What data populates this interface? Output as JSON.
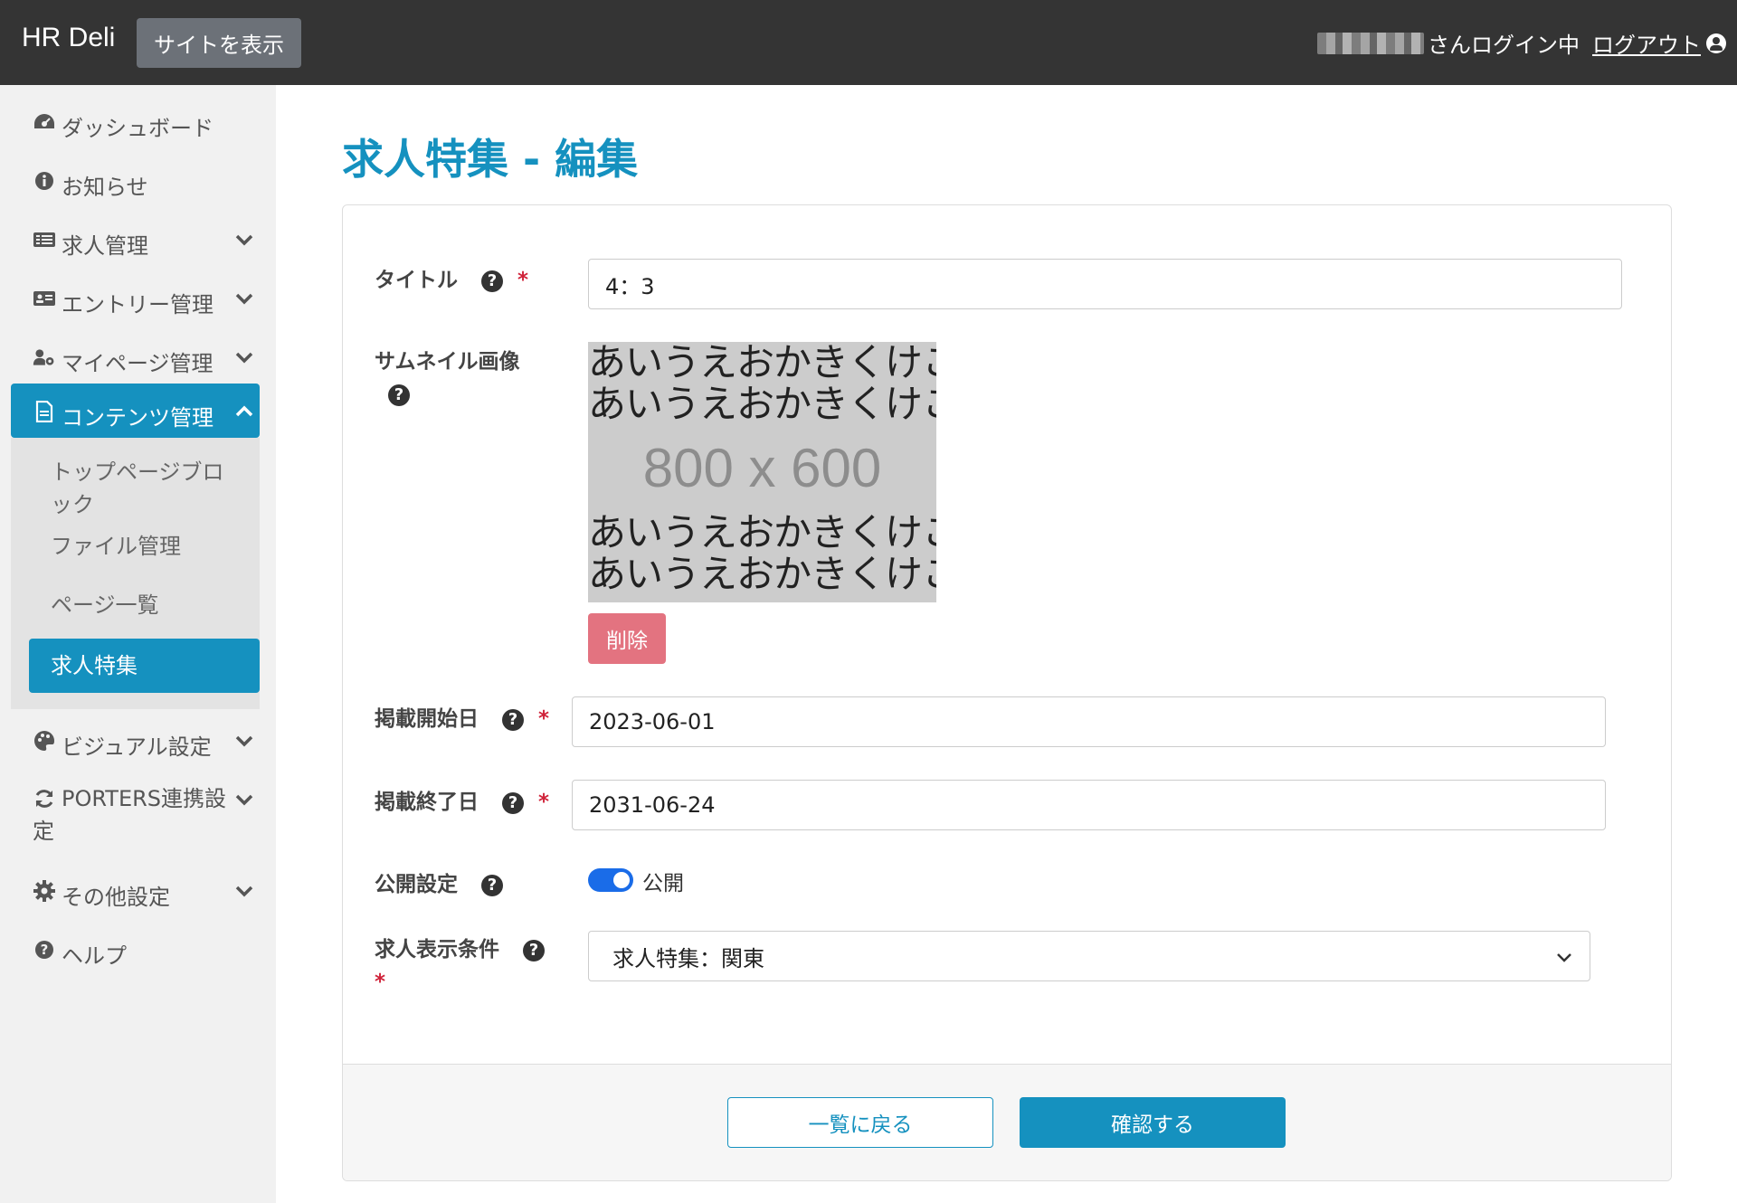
{
  "header": {
    "brand": "HR Deli",
    "site_button": "サイトを表示",
    "user_suffix": "さんログイン中",
    "logout": "ログアウト"
  },
  "sidebar": {
    "items": [
      {
        "label": "ダッシュボード",
        "icon": "dashboard-icon"
      },
      {
        "label": "お知らせ",
        "icon": "info-icon"
      },
      {
        "label": "求人管理",
        "icon": "list-icon",
        "expandable": true
      },
      {
        "label": "エントリー管理",
        "icon": "id-card-icon",
        "expandable": true
      },
      {
        "label": "マイページ管理",
        "icon": "user-gear-icon",
        "expandable": true
      },
      {
        "label": "コンテンツ管理",
        "icon": "file-icon",
        "expandable": true,
        "expanded": true
      },
      {
        "label": "ビジュアル設定",
        "icon": "palette-icon",
        "expandable": true
      },
      {
        "label": "PORTERS連携設定",
        "icon": "sync-icon",
        "expandable": true
      },
      {
        "label": "その他設定",
        "icon": "gear-icon",
        "expandable": true
      },
      {
        "label": "ヘルプ",
        "icon": "question-icon"
      }
    ],
    "submenu": [
      {
        "label": "トップページブロック"
      },
      {
        "label": "ファイル管理"
      },
      {
        "label": "ページ一覧"
      },
      {
        "label": "求人特集",
        "active": true
      }
    ]
  },
  "page": {
    "title": "求人特集 - 編集"
  },
  "form": {
    "title_label": "タイトル",
    "title_value": "4：3",
    "thumbnail_label": "サムネイル画像",
    "thumbnail_text_line": "あいうえおかきくけこさ",
    "thumbnail_size": "800 x 600",
    "delete_button": "削除",
    "start_label": "掲載開始日",
    "start_value": "2023-06-01",
    "end_label": "掲載終了日",
    "end_value": "2031-06-24",
    "publish_label": "公開設定",
    "publish_state": "公開",
    "publish_on": true,
    "condition_label": "求人表示条件",
    "condition_value": "求人特集：関東",
    "required_mark": "*",
    "help_mark": "?"
  },
  "footer": {
    "back_button": "一覧に戻る",
    "confirm_button": "確認する"
  },
  "colors": {
    "accent": "#1591bf",
    "header_bg": "#343434",
    "danger": "#e37380",
    "toggle_on": "#1a6ce8"
  }
}
